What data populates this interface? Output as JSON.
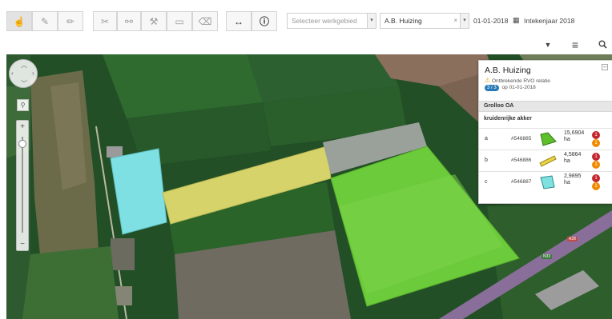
{
  "toolbar": {
    "tools": [
      {
        "name": "select-tool",
        "icon": "pointer-hand-icon",
        "glyph": "☝"
      },
      {
        "name": "draw-tool",
        "icon": "pen-icon",
        "glyph": "✎"
      },
      {
        "name": "edit-tool",
        "icon": "pencil-icon",
        "glyph": "✏"
      },
      {
        "name": "cut-tool",
        "icon": "scissors-icon",
        "glyph": "✂"
      },
      {
        "name": "link-tool",
        "icon": "link-icon",
        "glyph": "⚯"
      },
      {
        "name": "wrench-tool",
        "icon": "wrench-icon",
        "glyph": "⚒"
      },
      {
        "name": "note-tool",
        "icon": "edit-note-icon",
        "glyph": "▭"
      },
      {
        "name": "eraser-tool",
        "icon": "eraser-icon",
        "glyph": "⌫"
      },
      {
        "name": "measure-tool",
        "icon": "arrows-horizontal-icon",
        "glyph": "↔"
      },
      {
        "name": "info-tool",
        "icon": "info-icon",
        "glyph": "ℹ"
      }
    ],
    "area_select_placeholder": "Selecteer werkgebied",
    "company_value": "A.B. Huizing",
    "date_value": "01-01-2018",
    "year_label": "Intekenjaar 2018"
  },
  "right_buttons": [
    {
      "name": "filter-button",
      "icon": "filter-icon",
      "glyph": "▼"
    },
    {
      "name": "menu-button",
      "icon": "hamburger-menu-icon",
      "glyph": "≡"
    },
    {
      "name": "search-button",
      "icon": "search-icon",
      "glyph": "🔍"
    }
  ],
  "panel": {
    "title": "A.B. Huizing",
    "warning": "Ontbrekende RVO relatie",
    "count": "3 / 3",
    "date_text": "op 01-01-2018",
    "group": "Grolloo OA",
    "subheader": "kruidenrijke akker",
    "rows": [
      {
        "letter": "a",
        "id": "#546885",
        "area": "15,6904",
        "unit": "ha",
        "badge_red": "1",
        "badge_orange": "1",
        "color": "#5fbf2a"
      },
      {
        "letter": "b",
        "id": "#546886",
        "area": "4,5864",
        "unit": "ha",
        "badge_red": "1",
        "badge_orange": "1",
        "color": "#e8d24a"
      },
      {
        "letter": "c",
        "id": "#546887",
        "area": "2,9895",
        "unit": "ha",
        "badge_red": "1",
        "badge_orange": "1",
        "color": "#7fe0e0"
      }
    ]
  },
  "map": {
    "road_labels": [
      "A28",
      "N33"
    ],
    "zoom_plus": "+",
    "zoom_minus": "−"
  }
}
